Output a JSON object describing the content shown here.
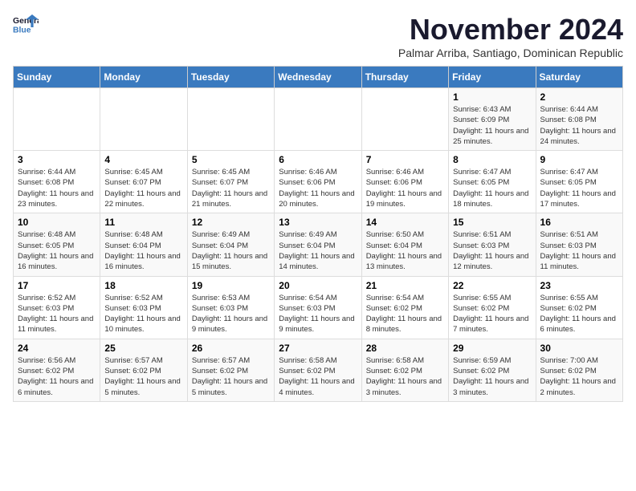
{
  "logo": {
    "line1": "General",
    "line2": "Blue"
  },
  "title": "November 2024",
  "subtitle": "Palmar Arriba, Santiago, Dominican Republic",
  "days_of_week": [
    "Sunday",
    "Monday",
    "Tuesday",
    "Wednesday",
    "Thursday",
    "Friday",
    "Saturday"
  ],
  "weeks": [
    [
      {
        "day": "",
        "info": ""
      },
      {
        "day": "",
        "info": ""
      },
      {
        "day": "",
        "info": ""
      },
      {
        "day": "",
        "info": ""
      },
      {
        "day": "",
        "info": ""
      },
      {
        "day": "1",
        "info": "Sunrise: 6:43 AM\nSunset: 6:09 PM\nDaylight: 11 hours and 25 minutes."
      },
      {
        "day": "2",
        "info": "Sunrise: 6:44 AM\nSunset: 6:08 PM\nDaylight: 11 hours and 24 minutes."
      }
    ],
    [
      {
        "day": "3",
        "info": "Sunrise: 6:44 AM\nSunset: 6:08 PM\nDaylight: 11 hours and 23 minutes."
      },
      {
        "day": "4",
        "info": "Sunrise: 6:45 AM\nSunset: 6:07 PM\nDaylight: 11 hours and 22 minutes."
      },
      {
        "day": "5",
        "info": "Sunrise: 6:45 AM\nSunset: 6:07 PM\nDaylight: 11 hours and 21 minutes."
      },
      {
        "day": "6",
        "info": "Sunrise: 6:46 AM\nSunset: 6:06 PM\nDaylight: 11 hours and 20 minutes."
      },
      {
        "day": "7",
        "info": "Sunrise: 6:46 AM\nSunset: 6:06 PM\nDaylight: 11 hours and 19 minutes."
      },
      {
        "day": "8",
        "info": "Sunrise: 6:47 AM\nSunset: 6:05 PM\nDaylight: 11 hours and 18 minutes."
      },
      {
        "day": "9",
        "info": "Sunrise: 6:47 AM\nSunset: 6:05 PM\nDaylight: 11 hours and 17 minutes."
      }
    ],
    [
      {
        "day": "10",
        "info": "Sunrise: 6:48 AM\nSunset: 6:05 PM\nDaylight: 11 hours and 16 minutes."
      },
      {
        "day": "11",
        "info": "Sunrise: 6:48 AM\nSunset: 6:04 PM\nDaylight: 11 hours and 16 minutes."
      },
      {
        "day": "12",
        "info": "Sunrise: 6:49 AM\nSunset: 6:04 PM\nDaylight: 11 hours and 15 minutes."
      },
      {
        "day": "13",
        "info": "Sunrise: 6:49 AM\nSunset: 6:04 PM\nDaylight: 11 hours and 14 minutes."
      },
      {
        "day": "14",
        "info": "Sunrise: 6:50 AM\nSunset: 6:04 PM\nDaylight: 11 hours and 13 minutes."
      },
      {
        "day": "15",
        "info": "Sunrise: 6:51 AM\nSunset: 6:03 PM\nDaylight: 11 hours and 12 minutes."
      },
      {
        "day": "16",
        "info": "Sunrise: 6:51 AM\nSunset: 6:03 PM\nDaylight: 11 hours and 11 minutes."
      }
    ],
    [
      {
        "day": "17",
        "info": "Sunrise: 6:52 AM\nSunset: 6:03 PM\nDaylight: 11 hours and 11 minutes."
      },
      {
        "day": "18",
        "info": "Sunrise: 6:52 AM\nSunset: 6:03 PM\nDaylight: 11 hours and 10 minutes."
      },
      {
        "day": "19",
        "info": "Sunrise: 6:53 AM\nSunset: 6:03 PM\nDaylight: 11 hours and 9 minutes."
      },
      {
        "day": "20",
        "info": "Sunrise: 6:54 AM\nSunset: 6:03 PM\nDaylight: 11 hours and 9 minutes."
      },
      {
        "day": "21",
        "info": "Sunrise: 6:54 AM\nSunset: 6:02 PM\nDaylight: 11 hours and 8 minutes."
      },
      {
        "day": "22",
        "info": "Sunrise: 6:55 AM\nSunset: 6:02 PM\nDaylight: 11 hours and 7 minutes."
      },
      {
        "day": "23",
        "info": "Sunrise: 6:55 AM\nSunset: 6:02 PM\nDaylight: 11 hours and 6 minutes."
      }
    ],
    [
      {
        "day": "24",
        "info": "Sunrise: 6:56 AM\nSunset: 6:02 PM\nDaylight: 11 hours and 6 minutes."
      },
      {
        "day": "25",
        "info": "Sunrise: 6:57 AM\nSunset: 6:02 PM\nDaylight: 11 hours and 5 minutes."
      },
      {
        "day": "26",
        "info": "Sunrise: 6:57 AM\nSunset: 6:02 PM\nDaylight: 11 hours and 5 minutes."
      },
      {
        "day": "27",
        "info": "Sunrise: 6:58 AM\nSunset: 6:02 PM\nDaylight: 11 hours and 4 minutes."
      },
      {
        "day": "28",
        "info": "Sunrise: 6:58 AM\nSunset: 6:02 PM\nDaylight: 11 hours and 3 minutes."
      },
      {
        "day": "29",
        "info": "Sunrise: 6:59 AM\nSunset: 6:02 PM\nDaylight: 11 hours and 3 minutes."
      },
      {
        "day": "30",
        "info": "Sunrise: 7:00 AM\nSunset: 6:02 PM\nDaylight: 11 hours and 2 minutes."
      }
    ]
  ]
}
